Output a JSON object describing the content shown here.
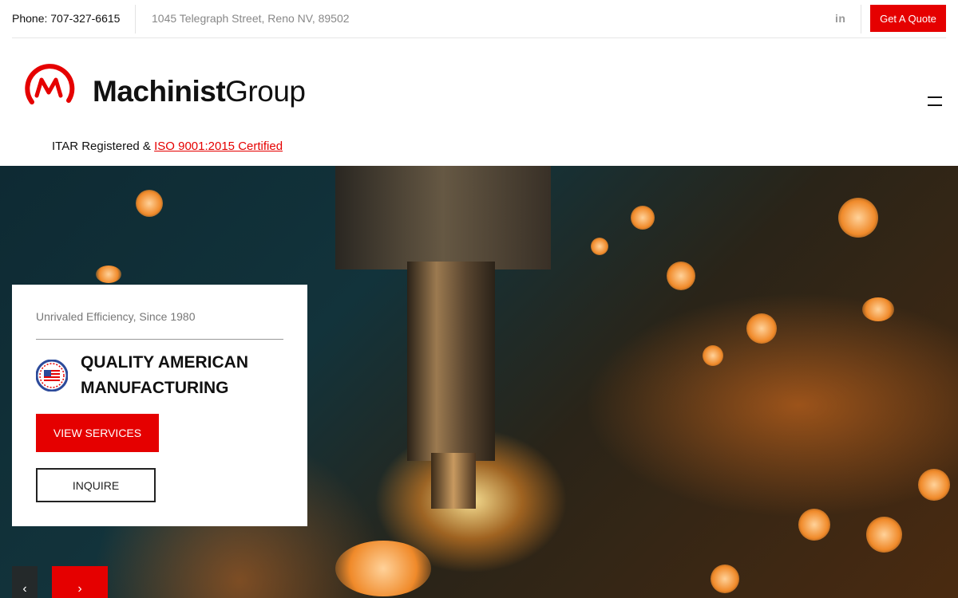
{
  "topbar": {
    "phone_label": "Phone:",
    "phone_number": "707-327-6615",
    "address": "1045 Telegraph Street, Reno NV, 89502",
    "social_icon": "linkedin-icon",
    "social_text": "in",
    "quote_button": "Get A Quote"
  },
  "header": {
    "logo_bold": "Machinist",
    "logo_light": "Group",
    "cert_prefix": "ITAR Registered & ",
    "cert_link": "ISO 9001:2015 Certified",
    "menu_icon": "hamburger-menu-icon"
  },
  "hero": {
    "tagline": "Unrivaled Efficiency, Since 1980",
    "badge_icon": "american-flag-badge-icon",
    "title_line1": "QUALITY AMERICAN",
    "title_line2": "MANUFACTURING",
    "primary_button": "VIEW SERVICES",
    "secondary_button": "INQUIRE",
    "prev_arrow": "‹",
    "next_arrow": "›"
  },
  "colors": {
    "accent": "#e50000",
    "text": "#111111",
    "muted": "#888888"
  }
}
